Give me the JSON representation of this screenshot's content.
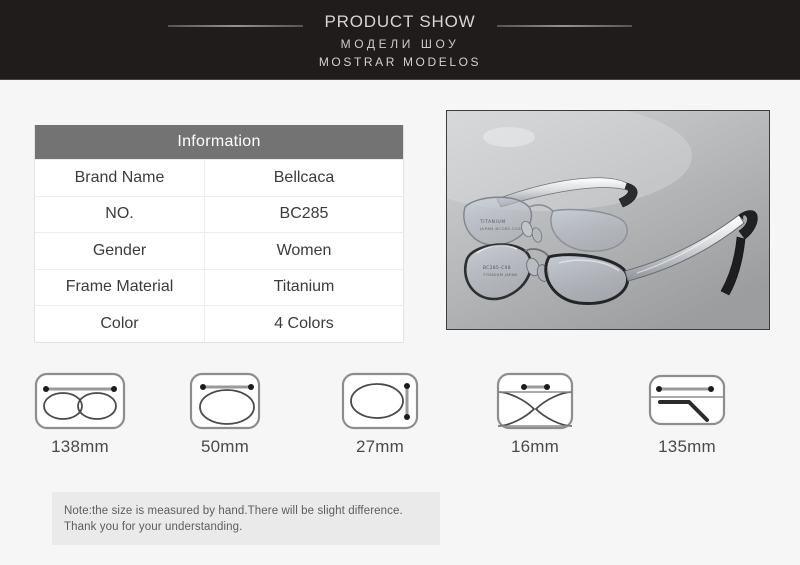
{
  "header": {
    "title": "PRODUCT SHOW",
    "subtitle_ru": "МОДЕЛИ ШОУ",
    "subtitle_es": "MOSTRAR MODELOS",
    "background_color": "#201c1b",
    "text_color": "#d9d4d1"
  },
  "info_table": {
    "header_label": "Information",
    "header_bg": "#737373",
    "rows": [
      {
        "label": "Brand Name",
        "value": "Bellcaca"
      },
      {
        "label": "NO.",
        "value": "BC285"
      },
      {
        "label": "Gender",
        "value": "Women"
      },
      {
        "label": "Frame Material",
        "value": "Titanium"
      },
      {
        "label": "Color",
        "value": "4 Colors"
      }
    ]
  },
  "product_photo": {
    "alt": "titanium-eyeglasses-frame-photo",
    "background_color": "#b9bbbd",
    "border_color": "#3d3d3d"
  },
  "specs": [
    {
      "icon": "frame-width-icon",
      "value": "138mm"
    },
    {
      "icon": "lens-width-icon",
      "value": "50mm"
    },
    {
      "icon": "lens-height-icon",
      "value": "27mm"
    },
    {
      "icon": "bridge-width-icon",
      "value": "16mm"
    },
    {
      "icon": "temple-length-icon",
      "value": "135mm"
    }
  ],
  "note": {
    "line1": "Note:the size is measured by hand.There will be slight difference.",
    "line2": "Thank you for your understanding.",
    "background_color": "#eaeaea"
  }
}
